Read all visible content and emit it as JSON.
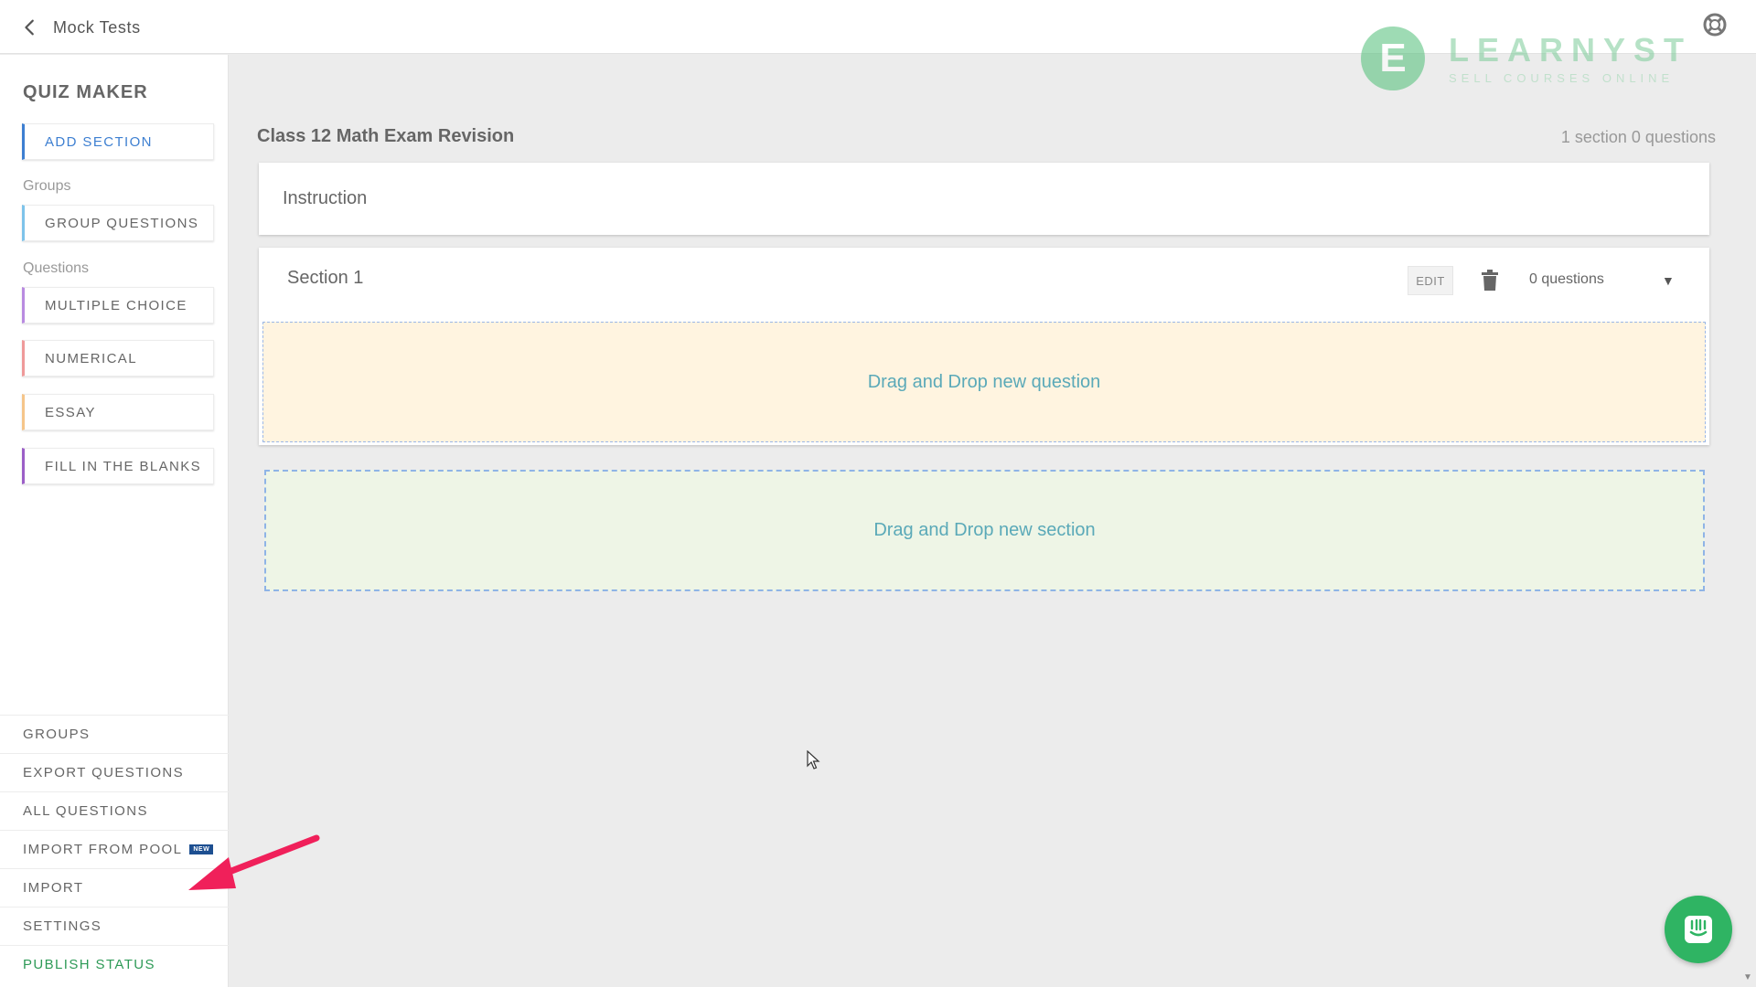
{
  "header": {
    "back_label": "Mock Tests",
    "brand": {
      "letter": "E",
      "name": "LEARNYST",
      "tagline": "SELL COURSES ONLINE",
      "color": "#4fbf77"
    }
  },
  "sidebar": {
    "title": "QUIZ MAKER",
    "add_section": "ADD SECTION",
    "groups_label": "Groups",
    "group_questions": "GROUP QUESTIONS",
    "questions_label": "Questions",
    "question_types": [
      {
        "label": "MULTIPLE CHOICE",
        "color": "#b98be0"
      },
      {
        "label": "NUMERICAL",
        "color": "#ef9a9a"
      },
      {
        "label": "ESSAY",
        "color": "#f5c58a"
      },
      {
        "label": "FILL IN THE BLANKS",
        "color": "#9c5fc7"
      }
    ],
    "menu": [
      {
        "label": "GROUPS"
      },
      {
        "label": "EXPORT QUESTIONS"
      },
      {
        "label": "ALL QUESTIONS"
      },
      {
        "label": "IMPORT FROM POOL",
        "badge": "NEW"
      },
      {
        "label": "IMPORT"
      },
      {
        "label": "SETTINGS"
      },
      {
        "label": "PUBLISH STATUS"
      }
    ]
  },
  "main": {
    "quiz_title": "Class 12 Math Exam Revision",
    "summary": "1 section 0 questions",
    "instruction_label": "Instruction",
    "section": {
      "title": "Section 1",
      "edit_label": "EDIT",
      "question_count": "0 questions",
      "drop_question": "Drag and Drop new question"
    },
    "drop_section": "Drag and Drop new section"
  },
  "colors": {
    "accent_blue": "#3d7fd1",
    "publish_green": "#2e9a57",
    "annotation_arrow": "#f0205a",
    "chat_button": "#2fb463"
  }
}
